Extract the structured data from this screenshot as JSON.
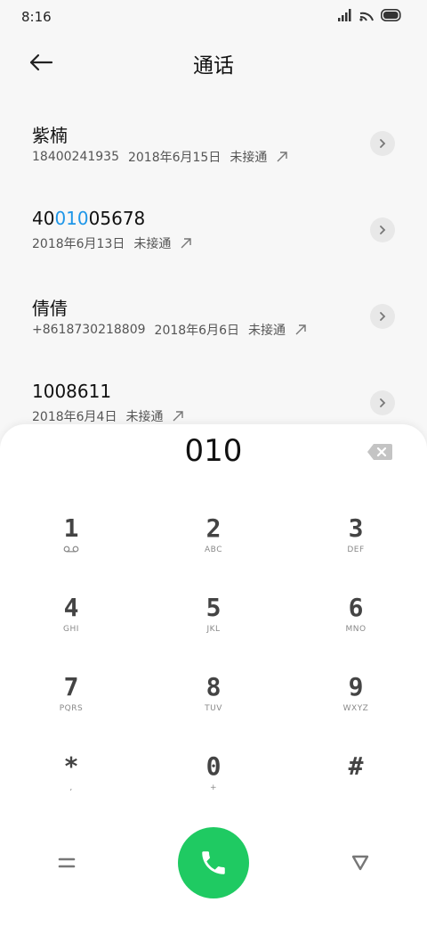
{
  "status": {
    "time": "8:16"
  },
  "header": {
    "title": "通话"
  },
  "calls": [
    {
      "name": "紫楠",
      "number": "18400241935",
      "date": "2018年6月15日",
      "status": "未接通"
    },
    {
      "name_prefix": "40",
      "name_highlight": "010",
      "name_suffix": "05678",
      "date": "2018年6月13日",
      "status": "未接通"
    },
    {
      "name": "倩倩",
      "number": "+8618730218809",
      "date": "2018年6月6日",
      "status": "未接通"
    },
    {
      "name": "1008611",
      "date": "2018年6月4日",
      "status": "未接通"
    }
  ],
  "dialpad": {
    "number": "010",
    "keys": [
      {
        "digit": "1",
        "letters": ""
      },
      {
        "digit": "2",
        "letters": "ABC"
      },
      {
        "digit": "3",
        "letters": "DEF"
      },
      {
        "digit": "4",
        "letters": "GHI"
      },
      {
        "digit": "5",
        "letters": "JKL"
      },
      {
        "digit": "6",
        "letters": "MNO"
      },
      {
        "digit": "7",
        "letters": "PQRS"
      },
      {
        "digit": "8",
        "letters": "TUV"
      },
      {
        "digit": "9",
        "letters": "WXYZ"
      },
      {
        "digit": "*",
        "letters": ","
      },
      {
        "digit": "0",
        "letters": "+"
      },
      {
        "digit": "#",
        "letters": ""
      }
    ]
  },
  "colors": {
    "highlight": "#1e96e8",
    "call_button": "#1fca62"
  }
}
